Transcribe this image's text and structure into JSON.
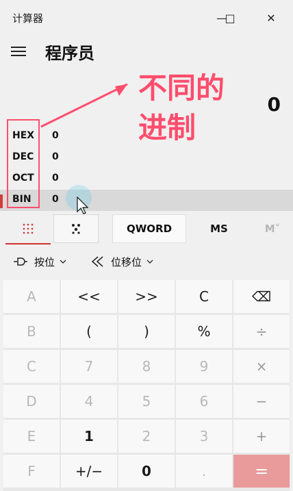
{
  "window": {
    "title": "计算器",
    "controls": {
      "minimize": "—",
      "maximize": "□",
      "close": "✕"
    }
  },
  "header": {
    "mode_title": "程序员"
  },
  "display": {
    "value": "0"
  },
  "annotation": {
    "text_line1": "不同的",
    "text_line2": "进制"
  },
  "radix": [
    {
      "label": "HEX",
      "value": "0"
    },
    {
      "label": "DEC",
      "value": "0"
    },
    {
      "label": "OCT",
      "value": "0"
    },
    {
      "label": "BIN",
      "value": "0"
    }
  ],
  "tabs": {
    "segment_qword": "QWORD",
    "segment_ms": "MS",
    "segment_m": "M˅"
  },
  "toolbar": {
    "bitwise": "按位",
    "bitshift": "位移位"
  },
  "keys": [
    [
      "A",
      "<<",
      ">>",
      "C",
      "⌫"
    ],
    [
      "B",
      "(",
      ")",
      "%",
      "÷"
    ],
    [
      "C",
      "7",
      "8",
      "9",
      "×"
    ],
    [
      "D",
      "4",
      "5",
      "6",
      "−"
    ],
    [
      "E",
      "1",
      "2",
      "3",
      "+"
    ],
    [
      "F",
      "+/−",
      "0",
      ".",
      "="
    ]
  ],
  "icons": {
    "hamburger": "menu-icon",
    "keypad": "keypad-icon",
    "bitshift_keypad": "bit-keypad-icon",
    "bitwise": "bitwise-icon",
    "shift": "shift-icon",
    "cursor": "pointer-icon"
  },
  "colors": {
    "accent": "#d32f2f",
    "annotation": "#ff4d6d",
    "equals": "#e99a9a"
  }
}
